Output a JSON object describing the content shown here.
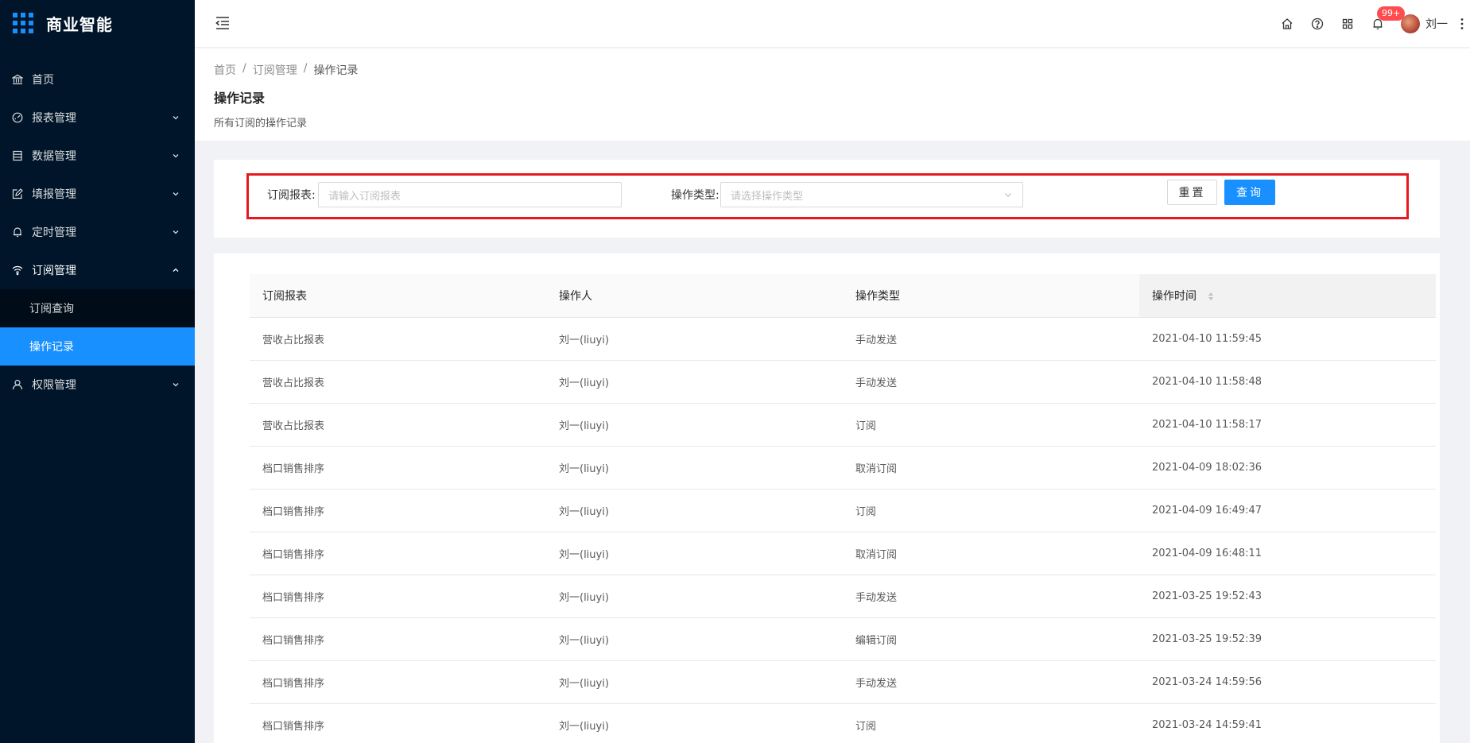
{
  "app": {
    "title": "商业智能"
  },
  "sidebar": {
    "items": [
      {
        "label": "首页",
        "icon": "bank-icon"
      },
      {
        "label": "报表管理",
        "icon": "dashboard-icon"
      },
      {
        "label": "数据管理",
        "icon": "database-icon"
      },
      {
        "label": "填报管理",
        "icon": "edit-icon"
      },
      {
        "label": "定时管理",
        "icon": "bell-icon"
      },
      {
        "label": "订阅管理",
        "icon": "wifi-icon",
        "open": true
      },
      {
        "label": "权限管理",
        "icon": "user-icon"
      }
    ],
    "subitems": [
      {
        "label": "订阅查询"
      },
      {
        "label": "操作记录",
        "active": true
      }
    ]
  },
  "header": {
    "notification_count": "99+",
    "user_name": "刘一"
  },
  "breadcrumb": {
    "items": [
      "首页",
      "订阅管理",
      "操作记录"
    ]
  },
  "page": {
    "title": "操作记录",
    "description": "所有订阅的操作记录"
  },
  "filter": {
    "report_label": "订阅报表:",
    "report_placeholder": "请输入订阅报表",
    "type_label": "操作类型:",
    "type_placeholder": "请选择操作类型",
    "reset_label": "重置",
    "query_label": "查询"
  },
  "table": {
    "columns": [
      "订阅报表",
      "操作人",
      "操作类型",
      "操作时间"
    ],
    "rows": [
      [
        "营收占比报表",
        "刘一(liuyi)",
        "手动发送",
        "2021-04-10 11:59:45"
      ],
      [
        "营收占比报表",
        "刘一(liuyi)",
        "手动发送",
        "2021-04-10 11:58:48"
      ],
      [
        "营收占比报表",
        "刘一(liuyi)",
        "订阅",
        "2021-04-10 11:58:17"
      ],
      [
        "档口销售排序",
        "刘一(liuyi)",
        "取消订阅",
        "2021-04-09 18:02:36"
      ],
      [
        "档口销售排序",
        "刘一(liuyi)",
        "订阅",
        "2021-04-09 16:49:47"
      ],
      [
        "档口销售排序",
        "刘一(liuyi)",
        "取消订阅",
        "2021-04-09 16:48:11"
      ],
      [
        "档口销售排序",
        "刘一(liuyi)",
        "手动发送",
        "2021-03-25 19:52:43"
      ],
      [
        "档口销售排序",
        "刘一(liuyi)",
        "编辑订阅",
        "2021-03-25 19:52:39"
      ],
      [
        "档口销售排序",
        "刘一(liuyi)",
        "手动发送",
        "2021-03-24 14:59:56"
      ],
      [
        "档口销售排序",
        "刘一(liuyi)",
        "订阅",
        "2021-03-24 14:59:41"
      ]
    ]
  },
  "colors": {
    "primary": "#1890ff",
    "sidebar_bg": "#001529",
    "highlight_border": "#e6191e",
    "badge": "#ff4d4f"
  }
}
